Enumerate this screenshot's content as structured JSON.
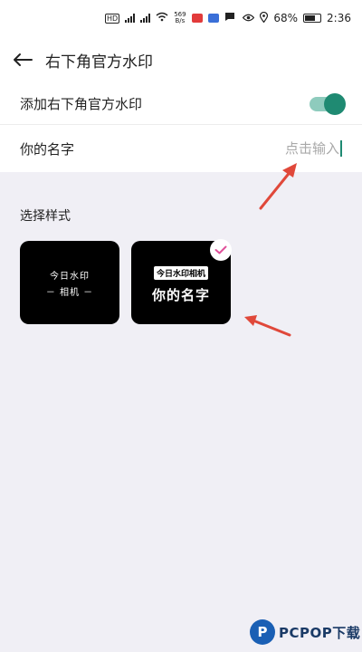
{
  "status_bar": {
    "hd_label": "HD",
    "net_speed_value": "569",
    "net_speed_unit": "B/s",
    "battery": "68%",
    "time": "2:36"
  },
  "header": {
    "title": "右下角官方水印"
  },
  "settings": {
    "toggle_label": "添加右下角官方水印",
    "toggle_on": true,
    "name_label": "你的名字",
    "name_placeholder": "点击输入"
  },
  "styles": {
    "section_title": "选择样式",
    "cards": [
      {
        "line1": "今日水印",
        "line2": "－ 相机 －",
        "selected": false
      },
      {
        "badge": "今日水印相机",
        "name": "你的名字",
        "selected": true
      }
    ]
  },
  "watermark": {
    "brand": "PCPOP下载"
  },
  "colors": {
    "accent": "#1f8a72",
    "annotation_arrow": "#e0483a",
    "check": "#e0509a"
  }
}
